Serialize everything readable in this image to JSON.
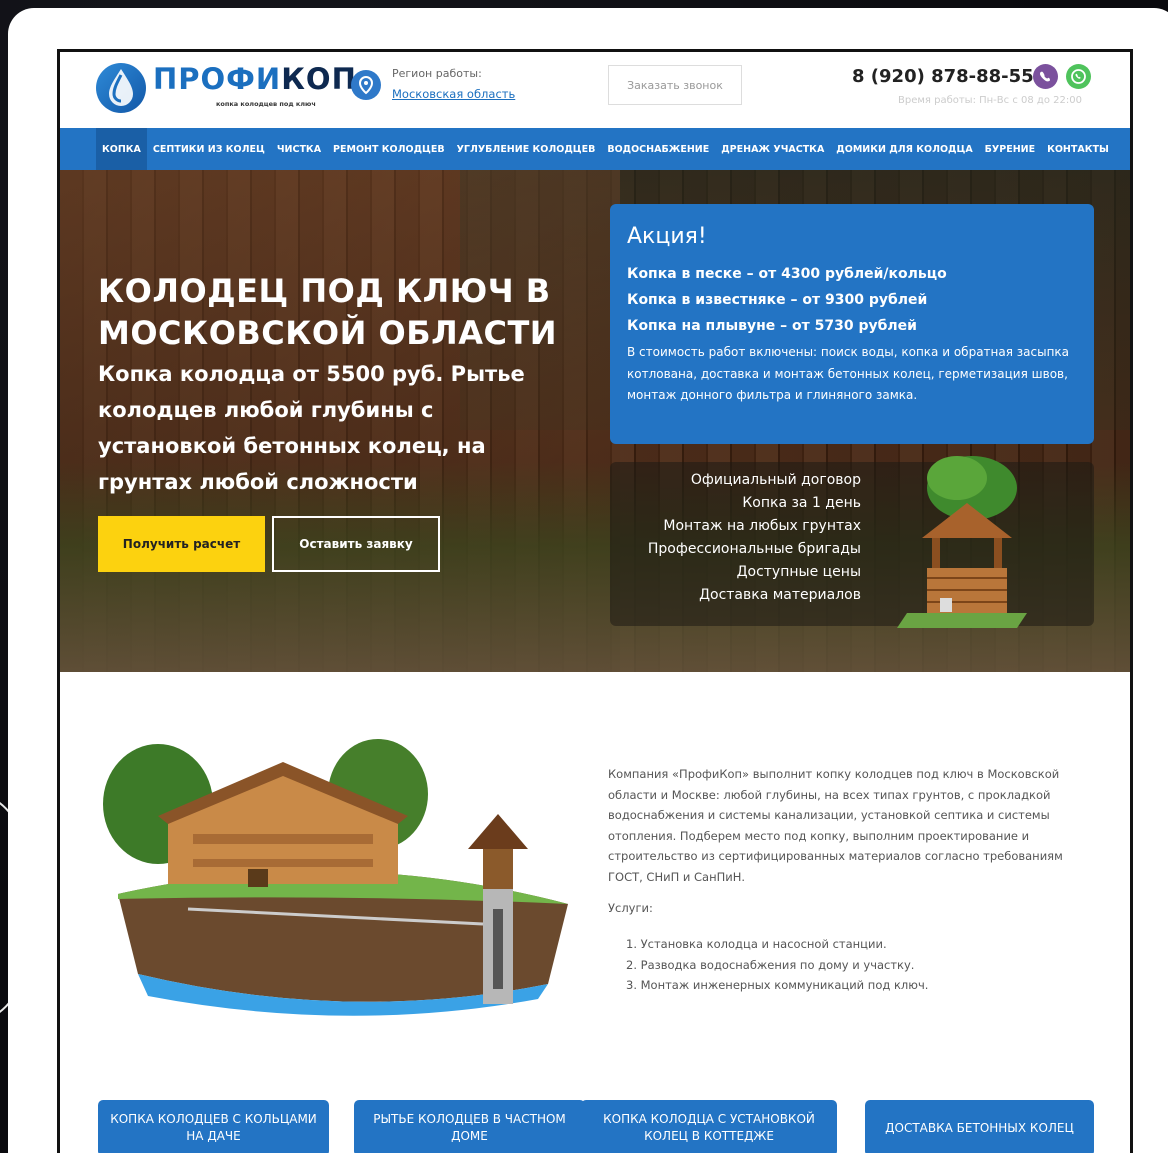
{
  "header": {
    "logo_main": "ПРОФИ",
    "logo_accent": "КОП",
    "logo_sub": "копка колодцев под ключ",
    "region_label": "Регион работы:",
    "region_link": "Московская область",
    "callback_label": "Заказать звонок",
    "phone": "8 (920) 878-88-55",
    "hours": "Время работы: Пн-Вс с 08 до 22:00"
  },
  "nav": {
    "items": [
      {
        "label": "КОПКА"
      },
      {
        "label": "СЕПТИКИ ИЗ КОЛЕЦ"
      },
      {
        "label": "ЧИСТКА"
      },
      {
        "label": "РЕМОНТ КОЛОДЦЕВ"
      },
      {
        "label": "УГЛУБЛЕНИЕ КОЛОДЦЕВ"
      },
      {
        "label": "ВОДОСНАБЖЕНИЕ"
      },
      {
        "label": "ДРЕНАЖ УЧАСТКА"
      },
      {
        "label": "ДОМИКИ ДЛЯ КОЛОДЦА"
      },
      {
        "label": "БУРЕНИЕ"
      },
      {
        "label": "КОНТАКТЫ"
      }
    ]
  },
  "hero": {
    "title": "КОЛОДЕЦ ПОД КЛЮЧ В МОСКОВСКОЙ ОБЛАСТИ",
    "subtitle": "Копка колодца от 5500 руб. Рытье колодцев любой глубины с установкой бетонных колец, на грунтах любой сложности",
    "calc_button": "Получить расчет",
    "order_button": "Оставить заявку"
  },
  "promo": {
    "title": "Акция!",
    "lines": [
      "Копка в песке – от 4300 рублей/кольцо",
      "Копка в известняке – от 9300 рублей",
      "Копка на плывуне – от 5730 рублей"
    ],
    "description": "В стоимость работ включены: поиск воды, копка и обратная засыпка котлована, доставка и монтаж бетонных колец, герметизация швов, монтаж донного фильтра и глиняного замка."
  },
  "features": [
    "Официальный договор",
    "Копка за 1 день",
    "Монтаж на любых грунтах",
    "Профессиональные бригады",
    "Доступные цены",
    "Доставка материалов"
  ],
  "about": {
    "text": "Компания «ПрофиКоп» выполнит копку колодцев под ключ в Московской области и Москве: любой глубины, на всех типах грунтов, с прокладкой водоснабжения и системы канализации, установкой септика и системы отопления. Подберем место под копку, выполним проектирование и строительство из сертифицированных материалов согласно требованиям ГОСТ, СНиП и СанПиН.",
    "services_label": "Услуги:",
    "services": [
      "1. Установка колодца и насосной станции.",
      "2. Разводка водоснабжения по дому и участку.",
      "3. Монтаж инженерных коммуникаций под ключ."
    ]
  },
  "cards": [
    "Копка колодцев с кольцами на даче",
    "Рытье колодцев в частном доме",
    "Копка колодца с установкой колец в коттедже",
    "Доставка бетонных колец"
  ],
  "colors": {
    "brand_blue": "#2374c4",
    "accent_yellow": "#fcd20f",
    "viber": "#7b519d",
    "whatsapp": "#4fc35c"
  },
  "icons": [
    "logo-drop-icon",
    "location-pin-icon",
    "viber-icon",
    "whatsapp-icon"
  ]
}
